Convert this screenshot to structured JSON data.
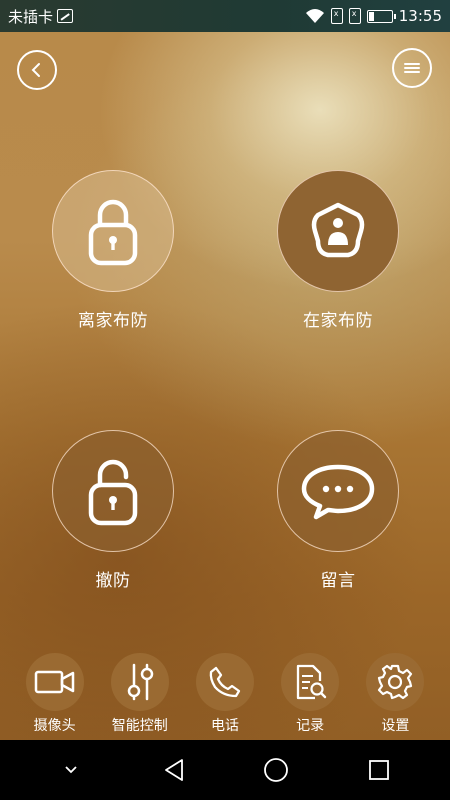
{
  "status_bar": {
    "carrier": "未插卡",
    "time": "13:55",
    "battery_level": 0.2
  },
  "modes": [
    {
      "label": "离家布防",
      "icon": "lock-closed-icon"
    },
    {
      "label": "在家布防",
      "icon": "home-person-icon"
    },
    {
      "label": "撤防",
      "icon": "lock-open-icon"
    },
    {
      "label": "留言",
      "icon": "message-bubble-icon"
    }
  ],
  "bottom_nav": [
    {
      "label": "摄像头",
      "icon": "video-camera-icon"
    },
    {
      "label": "智能控制",
      "icon": "slider-control-icon"
    },
    {
      "label": "电话",
      "icon": "phone-icon"
    },
    {
      "label": "记录",
      "icon": "record-search-icon"
    },
    {
      "label": "设置",
      "icon": "gear-icon"
    }
  ],
  "colors": {
    "accent_brown": "#9a6a32",
    "status_bar": "#1f3a34"
  }
}
